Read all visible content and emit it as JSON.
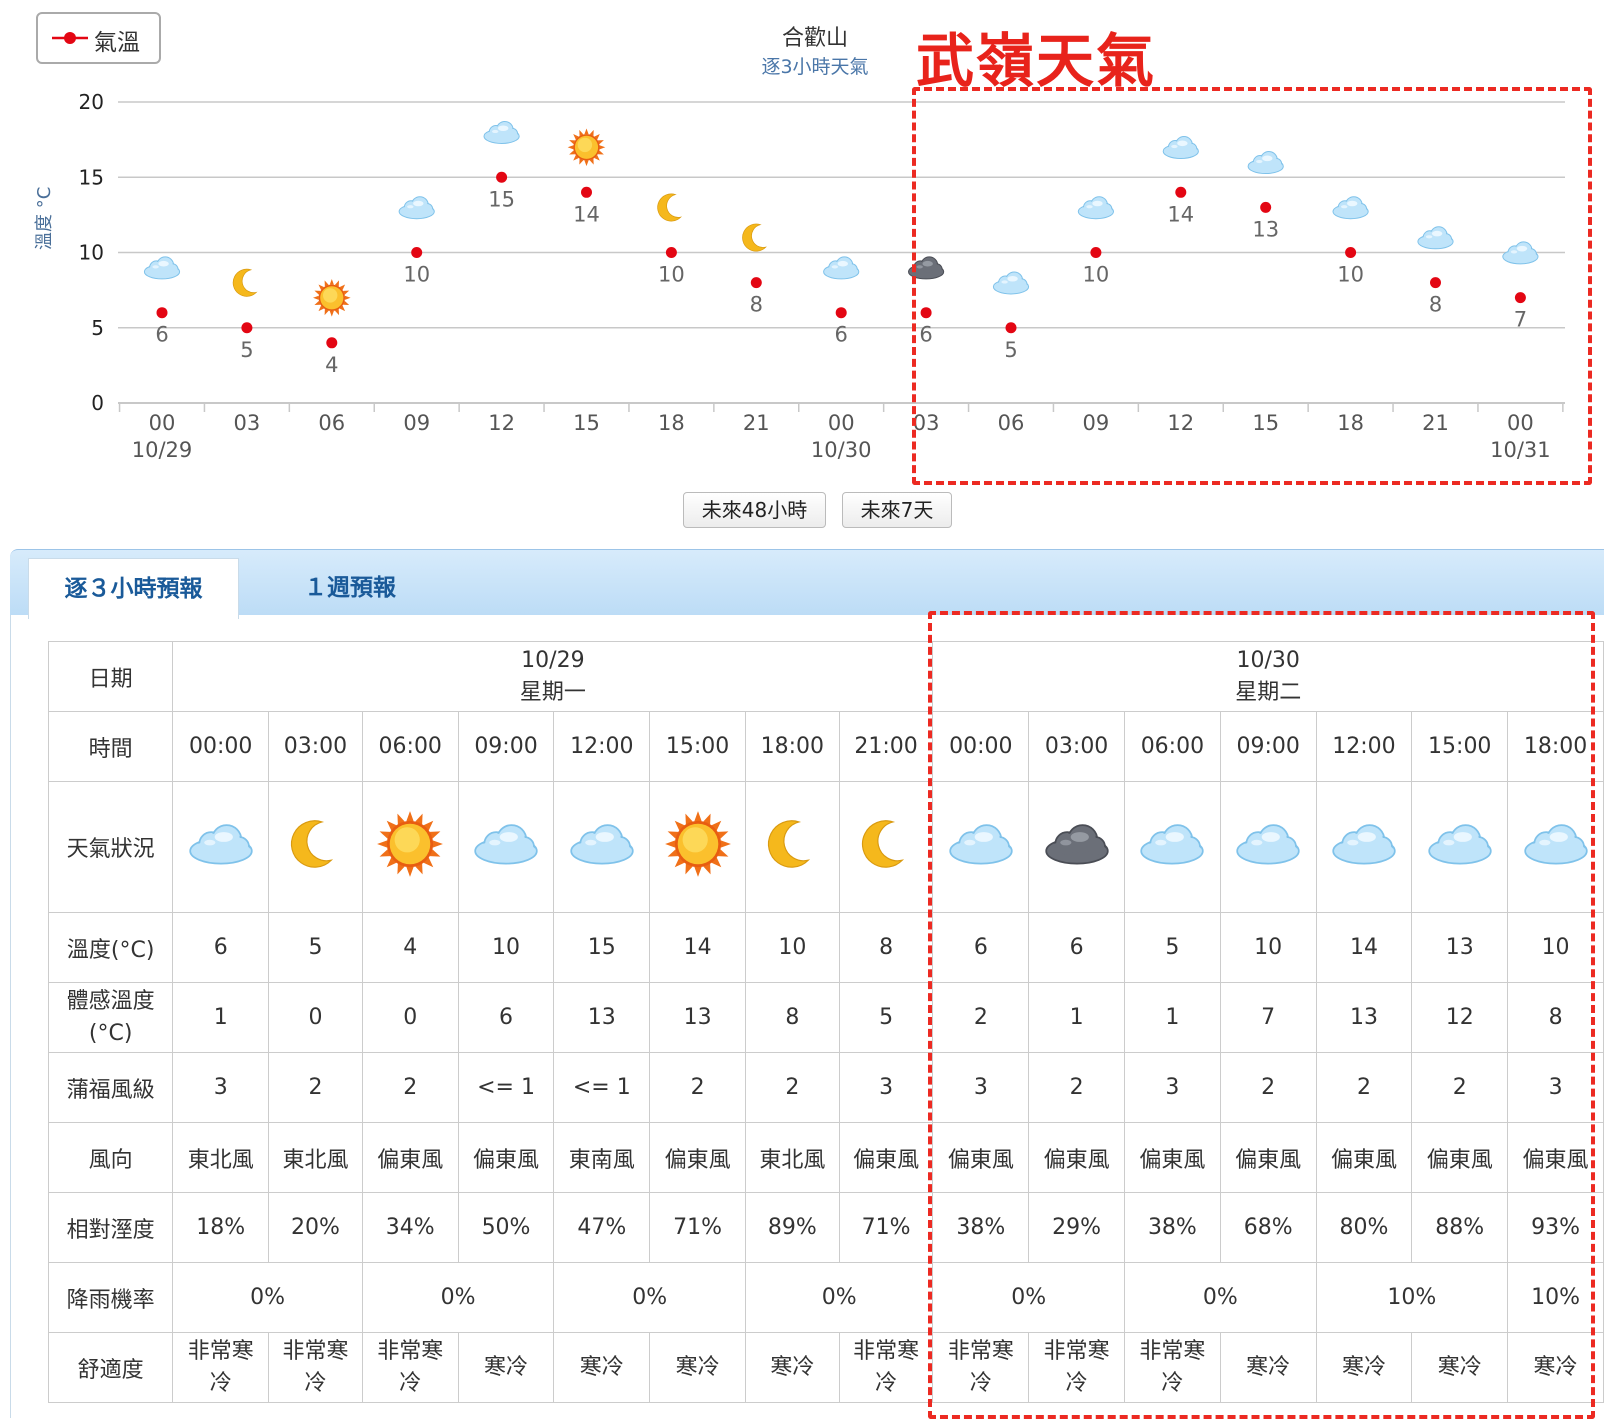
{
  "chart_data": {
    "type": "scatter",
    "title": "合歡山",
    "subtitle": "逐3小時天氣",
    "ylabel": "溫度 °C",
    "legend": [
      "氣溫"
    ],
    "legend_position": "top-left",
    "ylim": [
      0,
      20
    ],
    "yticks": [
      "0",
      "5",
      "10",
      "15",
      "20"
    ],
    "x_labels": [
      "00",
      "03",
      "06",
      "09",
      "12",
      "15",
      "18",
      "21",
      "00",
      "03",
      "06",
      "09",
      "12",
      "15",
      "18",
      "21",
      "00"
    ],
    "x_dates": [
      "10/29",
      "",
      "",
      "",
      "",
      "",
      "",
      "",
      "10/30",
      "",
      "",
      "",
      "",
      "",
      "",
      "",
      "10/31"
    ],
    "series": [
      {
        "name": "氣溫",
        "color": "#e30613",
        "values": [
          6,
          5,
          4,
          10,
          15,
          14,
          10,
          8,
          6,
          6,
          5,
          10,
          14,
          13,
          10,
          8,
          7
        ]
      }
    ],
    "icons": [
      "cloud",
      "moon",
      "sun",
      "cloud",
      "cloud",
      "sun",
      "moon",
      "moon",
      "cloud",
      "dark-cloud",
      "cloud",
      "cloud",
      "cloud",
      "cloud",
      "cloud",
      "cloud",
      "cloud"
    ],
    "grid": true
  },
  "annotation": "武嶺天氣",
  "buttons": {
    "b48": "未來48小時",
    "b7": "未來7天"
  },
  "tabs": {
    "active": "逐３小時預報",
    "other": "１週預報"
  },
  "table": {
    "row_labels": {
      "date": "日期",
      "time": "時間",
      "weather": "天氣狀況",
      "temp": "溫度(°C)",
      "feel": "體感溫度(°C)",
      "wind_level": "蒲福風級",
      "wind_dir": "風向",
      "humidity": "相對溼度",
      "rain": "降雨機率",
      "comfort": "舒適度"
    },
    "dates": [
      {
        "date": "10/29",
        "weekday": "星期一"
      },
      {
        "date": "10/30",
        "weekday": "星期二"
      }
    ],
    "times": [
      "00:00",
      "03:00",
      "06:00",
      "09:00",
      "12:00",
      "15:00",
      "18:00",
      "21:00",
      "00:00",
      "03:00",
      "06:00",
      "09:00",
      "12:00",
      "15:00",
      "18:00"
    ],
    "weather_icons": [
      "cloud",
      "moon",
      "sun",
      "cloud",
      "cloud",
      "sun",
      "moon",
      "moon",
      "cloud",
      "dark-cloud",
      "cloud",
      "cloud",
      "cloud",
      "cloud",
      "cloud"
    ],
    "temp": [
      "6",
      "5",
      "4",
      "10",
      "15",
      "14",
      "10",
      "8",
      "6",
      "6",
      "5",
      "10",
      "14",
      "13",
      "10"
    ],
    "feel": [
      "1",
      "0",
      "0",
      "6",
      "13",
      "13",
      "8",
      "5",
      "2",
      "1",
      "1",
      "7",
      "13",
      "12",
      "8"
    ],
    "wind_level": [
      "3",
      "2",
      "2",
      "<= 1",
      "<= 1",
      "2",
      "2",
      "3",
      "3",
      "2",
      "3",
      "2",
      "2",
      "2",
      "3"
    ],
    "wind_dir": [
      "東北風",
      "東北風",
      "偏東風",
      "偏東風",
      "東南風",
      "偏東風",
      "東北風",
      "偏東風",
      "偏東風",
      "偏東風",
      "偏東風",
      "偏東風",
      "偏東風",
      "偏東風",
      "偏東風"
    ],
    "humidity": [
      "18%",
      "20%",
      "34%",
      "50%",
      "47%",
      "71%",
      "89%",
      "71%",
      "38%",
      "29%",
      "38%",
      "68%",
      "80%",
      "88%",
      "93%"
    ],
    "rain": [
      "0%",
      "0%",
      "0%",
      "0%",
      "0%",
      "0%",
      "10%",
      "10%"
    ],
    "comfort": [
      "非常寒冷",
      "非常寒冷",
      "非常寒冷",
      "寒冷",
      "寒冷",
      "寒冷",
      "寒冷",
      "非常寒冷",
      "非常寒冷",
      "非常寒冷",
      "非常寒冷",
      "寒冷",
      "寒冷",
      "寒冷",
      "寒冷"
    ]
  }
}
